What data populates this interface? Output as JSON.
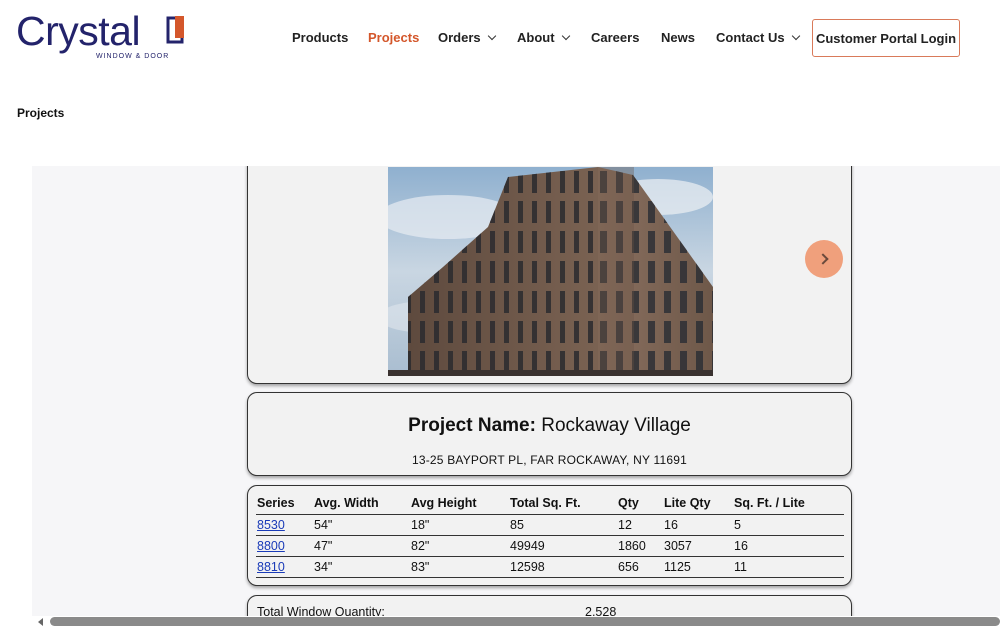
{
  "brand": {
    "name": "Crystal",
    "tagline": "WINDOW & DOOR",
    "accent": "#d4572b",
    "navy": "#23236b"
  },
  "nav": {
    "items": [
      {
        "label": "Products",
        "dropdown": false,
        "active": false
      },
      {
        "label": "Projects",
        "dropdown": false,
        "active": true
      },
      {
        "label": "Orders",
        "dropdown": true,
        "active": false
      },
      {
        "label": "About",
        "dropdown": true,
        "active": false
      },
      {
        "label": "Careers",
        "dropdown": false,
        "active": false
      },
      {
        "label": "News",
        "dropdown": false,
        "active": false
      },
      {
        "label": "Contact Us",
        "dropdown": true,
        "active": false
      }
    ],
    "portal_label": "Customer Portal Login"
  },
  "breadcrumb": "Projects",
  "project": {
    "name_label": "Project Name:",
    "name": "Rockaway Village",
    "address": "13-25 BAYPORT PL, FAR ROCKAWAY, NY 11691",
    "next_icon": "chevron-right-icon"
  },
  "table": {
    "headers": [
      "Series",
      "Avg. Width",
      "Avg Height",
      "Total Sq. Ft.",
      "Qty",
      "Lite Qty",
      "Sq. Ft. / Lite"
    ],
    "rows": [
      [
        "8530",
        "54\"",
        "18\"",
        "85",
        "12",
        "16",
        "5"
      ],
      [
        "8800",
        "47\"",
        "82\"",
        "49949",
        "1860",
        "3057",
        "16"
      ],
      [
        "8810",
        "34\"",
        "83\"",
        "12598",
        "656",
        "1125",
        "11"
      ]
    ]
  },
  "totals": {
    "label": "Total Window Quantity:",
    "value": "2,528"
  }
}
